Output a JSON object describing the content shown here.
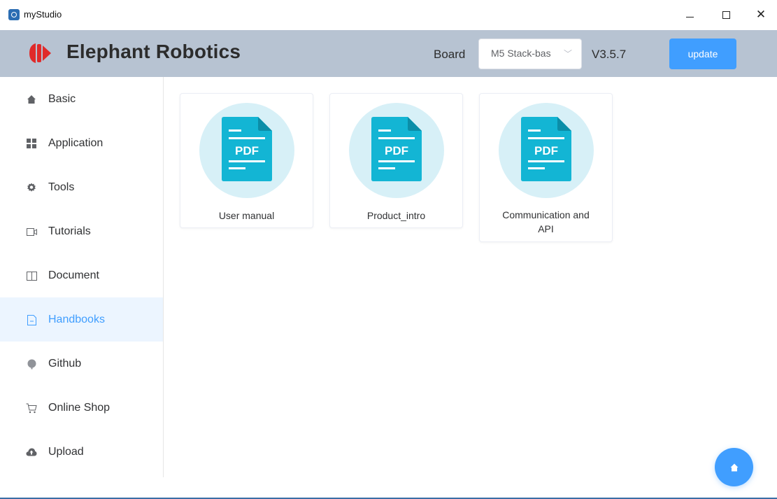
{
  "window": {
    "title": "myStudio",
    "close_glyph": "✕"
  },
  "header": {
    "brand": "Elephant Robotics",
    "board_label": "Board",
    "board_value": "M5 Stack-bas",
    "version": "V3.5.7",
    "update_label": "update",
    "colors": {
      "band": "#b7c3d2",
      "logo_red": "#e02a2a",
      "accent": "#409eff"
    }
  },
  "sidebar": {
    "active": "Handbooks",
    "items": [
      {
        "label": "Basic",
        "icon": "home-icon"
      },
      {
        "label": "Application",
        "icon": "grid-icon"
      },
      {
        "label": "Tools",
        "icon": "gear-icon"
      },
      {
        "label": "Tutorials",
        "icon": "video-icon"
      },
      {
        "label": "Document",
        "icon": "book-icon"
      },
      {
        "label": "Handbooks",
        "icon": "file-icon"
      },
      {
        "label": "Github",
        "icon": "github-icon"
      },
      {
        "label": "Online Shop",
        "icon": "cart-icon"
      },
      {
        "label": "Upload",
        "icon": "cloud-upload-icon"
      }
    ]
  },
  "main": {
    "cards": [
      {
        "label": "User manual",
        "badge": "PDF"
      },
      {
        "label": "Product_intro",
        "badge": "PDF"
      },
      {
        "label": "Communication and API",
        "badge": "PDF"
      }
    ]
  }
}
